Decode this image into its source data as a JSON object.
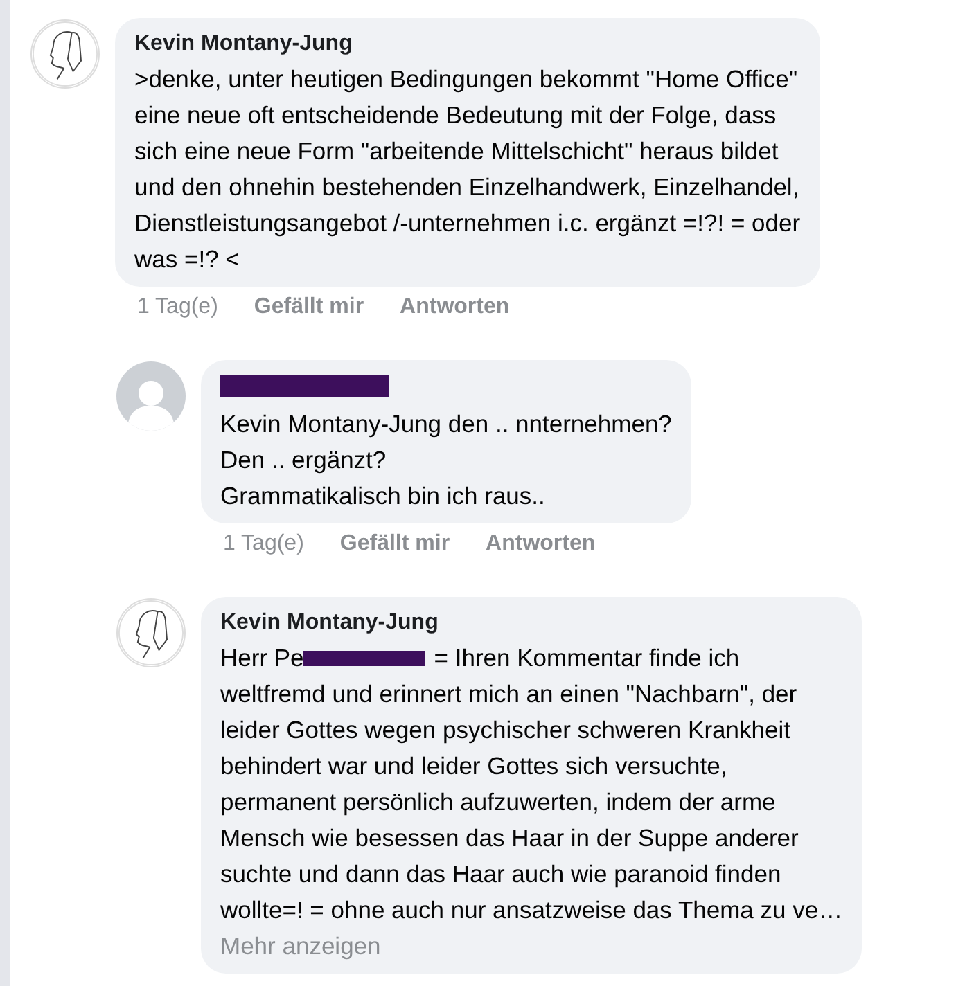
{
  "comments": [
    {
      "kind": "sketch",
      "author": "Kevin Montany-Jung",
      "author_redacted": false,
      "indent": false,
      "text": ">denke, unter heutigen Bedingungen bekommt \"Home Office\"\neine neue oft entscheidende Bedeutung mit der Folge, dass\nsich eine neue Form \"arbeitende Mittelschicht\" heraus bildet\nund den ohnehin bestehenden Einzelhandwerk, Einzelhandel,\nDienstleistungsangebot /-unternehmen i.c. ergänzt =!?! = oder\nwas =!? <",
      "actions": [
        "1 Tag(e)",
        "Gefällt mir",
        "Antworten"
      ]
    },
    {
      "kind": "default",
      "author_redacted": true,
      "indent": true,
      "text": "Kevin Montany-Jung den .. nnternehmen?\nDen .. ergänzt?\nGrammatikalisch bin ich raus..",
      "actions": [
        "1 Tag(e)",
        "Gefällt mir",
        "Antworten"
      ]
    },
    {
      "kind": "sketch",
      "author": "Kevin Montany-Jung",
      "author_redacted": false,
      "indent": true,
      "text_start": "Herr Pe",
      "text_start_end": "= Ihren Kommentar finde ich",
      "text": "weltfremd und erinnert mich an einen \"Nachbarn\", der\nleider Gottes wegen psychischer schweren Krankheit\nbehindert war und leider Gottes sich versuchte,\npermanent persönlich aufzuwerten, indem der arme\nMensch wie besessen das Haar in der Suppe anderer\nsuchte und dann das Haar auch wie paranoid finden\nwollte=! = ohne auch nur ansatzweise das Thema zu ve…",
      "more": "Mehr anzeigen"
    }
  ]
}
